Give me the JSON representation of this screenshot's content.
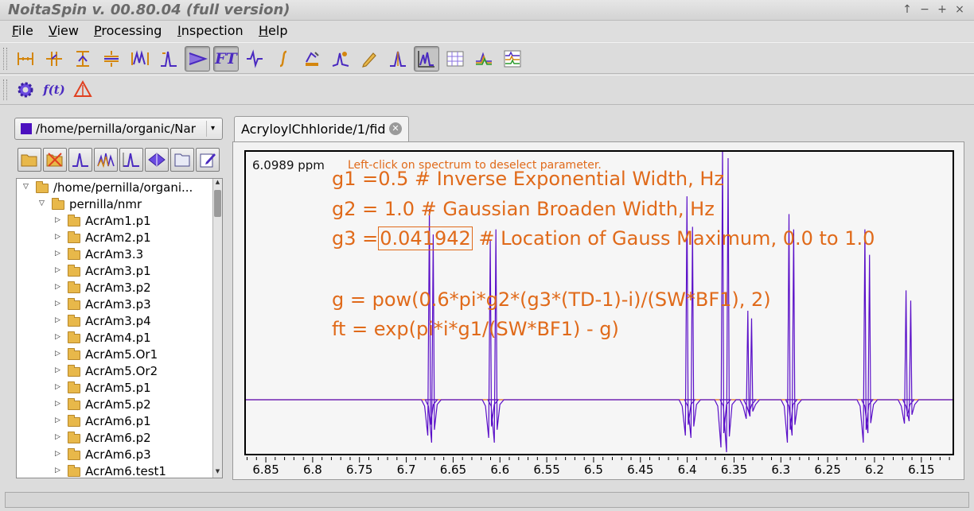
{
  "window": {
    "title": "NoitaSpin v. 00.80.04 (full version)",
    "controls": [
      "↑",
      "−",
      "+",
      "×"
    ]
  },
  "menu": [
    {
      "key": "F",
      "rest": "ile"
    },
    {
      "key": "V",
      "rest": "iew"
    },
    {
      "key": "P",
      "rest": "rocessing"
    },
    {
      "key": "I",
      "rest": "nspection"
    },
    {
      "key": "H",
      "rest": "elp"
    }
  ],
  "toolbar1": [
    "ruler-horizontal-icon",
    "phase-cursor-icon",
    "ruler-vertical-icon",
    "align-icon",
    "peak-region-icon",
    "peak-pick-icon",
    "apodization-icon",
    "fourier-transform-icon",
    "phase-correction-icon",
    "integral-icon",
    "baseline-icon",
    "peak-fit-icon",
    "pencil-icon",
    "single-peak-icon",
    "spectrum-view-icon",
    "grid-view-icon",
    "overlay-icon",
    "multi-spectrum-icon"
  ],
  "toolbar1_ft_label": "FT",
  "toolbar2": [
    "gear-icon",
    "function-icon",
    "warning-icon"
  ],
  "toolbar2_fn_label": "f(t)",
  "file_panel": {
    "path": "/home/pernilla/organic/Nar",
    "path_color": "#4b0fbf",
    "tools": [
      "open-folder-icon",
      "close-folder-icon",
      "spectrum-icon",
      "multiplet-icon",
      "peak-icon",
      "3d-surface-icon",
      "folder-outline-icon",
      "edit-icon"
    ],
    "tree": [
      {
        "label": "/home/pernilla/organi...",
        "level": 0,
        "expanded": true
      },
      {
        "label": "pernilla/nmr",
        "level": 1,
        "expanded": true
      },
      {
        "label": "AcrAm1.p1",
        "level": 2,
        "expanded": false
      },
      {
        "label": "AcrAm2.p1",
        "level": 2,
        "expanded": false
      },
      {
        "label": "AcrAm3.3",
        "level": 2,
        "expanded": false
      },
      {
        "label": "AcrAm3.p1",
        "level": 2,
        "expanded": false
      },
      {
        "label": "AcrAm3.p2",
        "level": 2,
        "expanded": false
      },
      {
        "label": "AcrAm3.p3",
        "level": 2,
        "expanded": false
      },
      {
        "label": "AcrAm3.p4",
        "level": 2,
        "expanded": false
      },
      {
        "label": "AcrAm4.p1",
        "level": 2,
        "expanded": false
      },
      {
        "label": "AcrAm5.Or1",
        "level": 2,
        "expanded": false
      },
      {
        "label": "AcrAm5.Or2",
        "level": 2,
        "expanded": false
      },
      {
        "label": "AcrAm5.p1",
        "level": 2,
        "expanded": false
      },
      {
        "label": "AcrAm5.p2",
        "level": 2,
        "expanded": false
      },
      {
        "label": "AcrAm6.p1",
        "level": 2,
        "expanded": false
      },
      {
        "label": "AcrAm6.p2",
        "level": 2,
        "expanded": false
      },
      {
        "label": "AcrAm6.p3",
        "level": 2,
        "expanded": false
      },
      {
        "label": "AcrAm6.test1",
        "level": 2,
        "expanded": false
      }
    ]
  },
  "tab": {
    "label": "AcryloylChhloride/1/fid"
  },
  "spectrum": {
    "cursor_ppm": "6.0989 ppm",
    "hint": "Left-click on spectrum to deselect parameter.",
    "g1_prefix": "g1 =0.5     # Inverse Exponential Width, Hz",
    "g2_line": "g2 = 1.0     # Gaussian Broaden Width, Hz",
    "g3_prefix": "g3 =",
    "g3_value": "0.041942",
    "g3_suffix": "      # Location of Gauss Maximum, 0.0 to 1.0",
    "g_line": "g  = pow(0.6*pi*g2*(g3*(TD-1)-i)/(SW*BF1), 2)",
    "ft_line": "ft = exp(pi*i*g1/(SW*BF1) - g)",
    "text_color": "#e06a1a",
    "trace_color": "#5a0fc8",
    "baseline_color": "#e06a1a",
    "x_range": [
      6.873,
      6.115
    ],
    "x_ticks": [
      "6.85",
      "6.8",
      "6.75",
      "6.7",
      "6.65",
      "6.6",
      "6.55",
      "6.5",
      "6.45",
      "6.4",
      "6.35",
      "6.3",
      "6.25",
      "6.2",
      "6.15"
    ],
    "peaks": [
      {
        "ppm": 6.677,
        "height": 0.75,
        "dip": 0.15
      },
      {
        "ppm": 6.673,
        "height": 0.65,
        "dip": 0.18
      },
      {
        "ppm": 6.612,
        "height": 0.63,
        "dip": 0.16
      },
      {
        "ppm": 6.606,
        "height": 0.67,
        "dip": 0.18
      },
      {
        "ppm": 6.402,
        "height": 0.8,
        "dip": 0.15
      },
      {
        "ppm": 6.396,
        "height": 0.68,
        "dip": 0.16
      },
      {
        "ppm": 6.364,
        "height": 1.0,
        "dip": 0.2
      },
      {
        "ppm": 6.358,
        "height": 0.95,
        "dip": 0.22
      },
      {
        "ppm": 6.337,
        "height": 0.35,
        "dip": 0.08
      },
      {
        "ppm": 6.333,
        "height": 0.32,
        "dip": 0.07
      },
      {
        "ppm": 6.293,
        "height": 0.73,
        "dip": 0.18
      },
      {
        "ppm": 6.288,
        "height": 0.67,
        "dip": 0.15
      },
      {
        "ppm": 6.212,
        "height": 0.67,
        "dip": 0.18
      },
      {
        "ppm": 6.207,
        "height": 0.57,
        "dip": 0.14
      },
      {
        "ppm": 6.168,
        "height": 0.43,
        "dip": 0.1
      },
      {
        "ppm": 6.163,
        "height": 0.39,
        "dip": 0.09
      }
    ]
  }
}
